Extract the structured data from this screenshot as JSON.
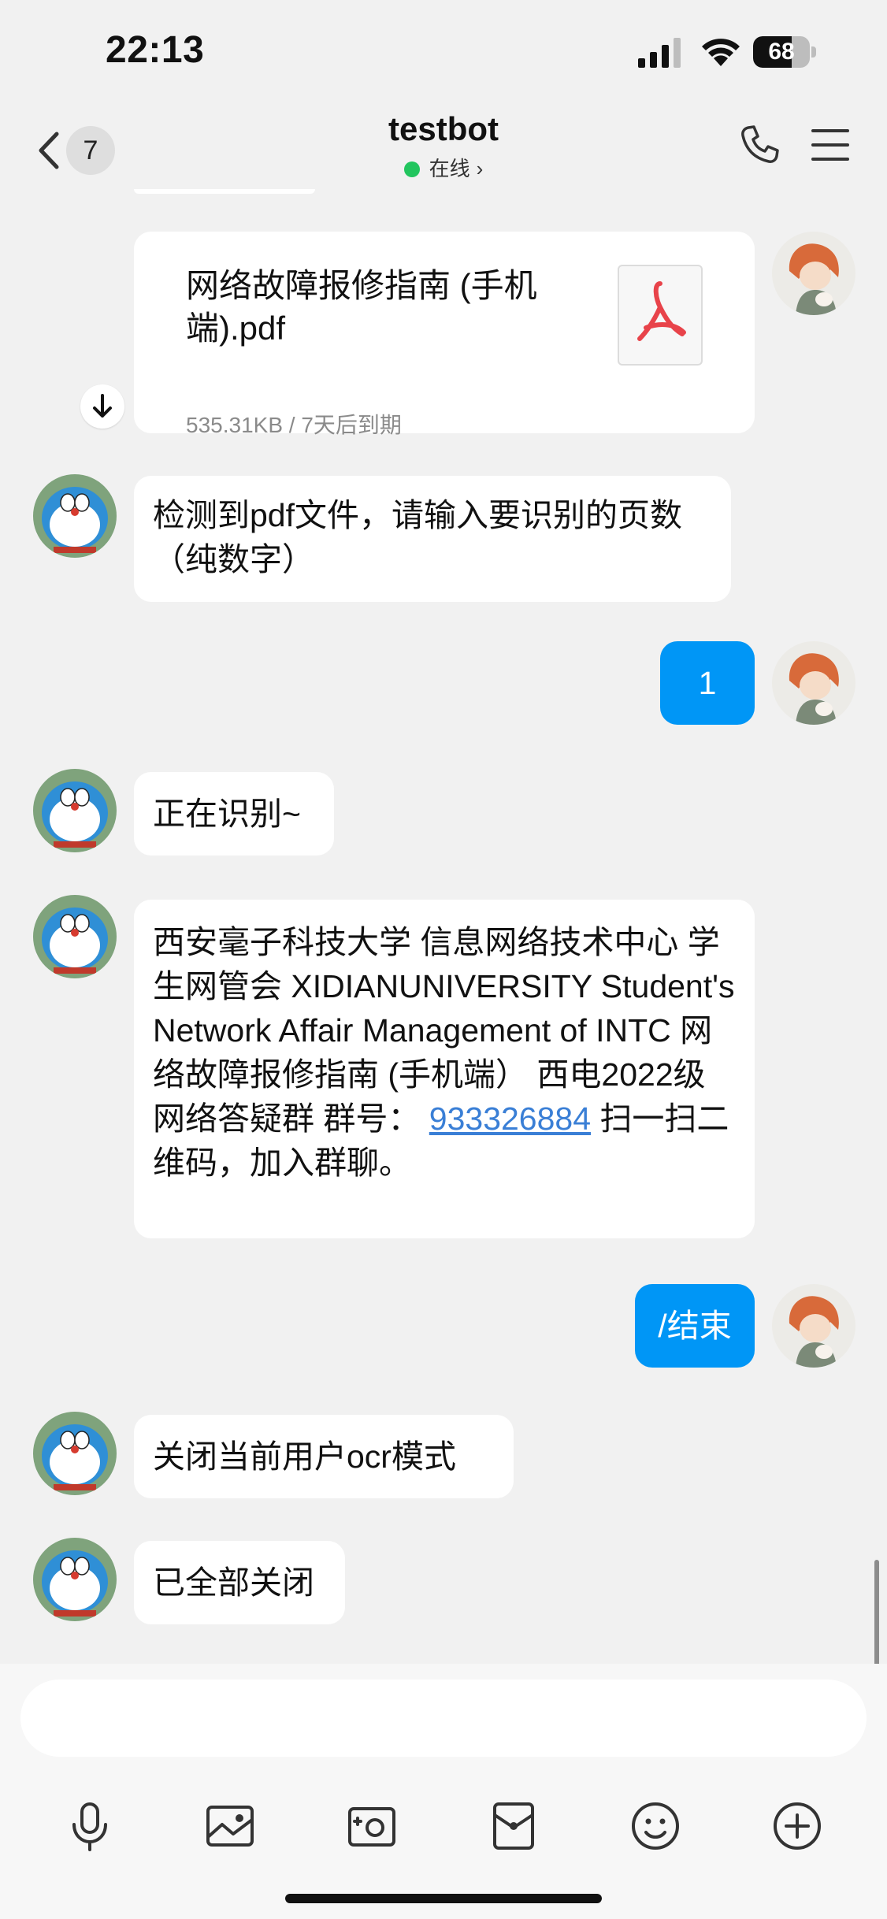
{
  "status_bar": {
    "time": "22:13",
    "battery": "68",
    "battery_level": 0.68
  },
  "header": {
    "back_count": "7",
    "title": "testbot",
    "presence": "在线"
  },
  "file_message": {
    "name": "网络故障报修指南 (手机端).pdf",
    "meta": "535.31KB / 7天后到期"
  },
  "messages": [
    {
      "from": "bot",
      "text": "检测到pdf文件，请输入要识别的页数（纯数字）"
    },
    {
      "from": "me",
      "text": "1"
    },
    {
      "from": "bot",
      "text": "正在识别~"
    },
    {
      "from": "bot",
      "text_before": "西安毫子科技大学 信息网络技术中心 学生网管会 XIDIANUNIVERSITY Student's Network Affair Management of INTC 网络故障报修指南 (手机端） 西电2022级网络答疑群 群号：",
      "link": "933326884",
      "text_after": "扫一扫二维码，加入群聊。"
    },
    {
      "from": "me",
      "text": "/结束"
    },
    {
      "from": "bot",
      "text": "关闭当前用户ocr模式"
    },
    {
      "from": "bot",
      "text": "已全部关闭"
    }
  ],
  "input": {
    "placeholder": ""
  },
  "toolbar": [
    "microphone-icon",
    "image-icon",
    "camera-icon",
    "red-packet-icon",
    "emoji-icon",
    "plus-icon"
  ],
  "colors": {
    "outgoing_bubble": "#0096f6",
    "online_dot": "#22c55e",
    "link": "#3a7fd6",
    "pdf_red": "#e8434a"
  }
}
